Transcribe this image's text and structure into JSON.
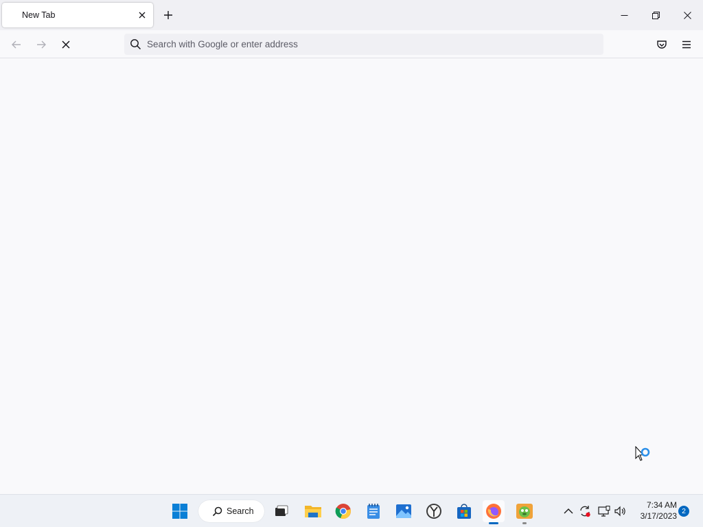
{
  "tab": {
    "title": "New Tab"
  },
  "urlbar": {
    "placeholder": "Search with Google or enter address",
    "value": ""
  },
  "taskbar": {
    "search_label": "Search",
    "apps": [
      "start",
      "task-view",
      "file-explorer",
      "chrome",
      "notepad",
      "photos",
      "clock",
      "microsoft-store",
      "firefox",
      "game"
    ],
    "active_app": "firefox"
  },
  "tray": {
    "time": "7:34 AM",
    "date": "3/17/2023",
    "notification_count": "2"
  },
  "colors": {
    "accent": "#0067c0",
    "tab_strip": "#f0f0f4",
    "page_bg": "#f9f9fb"
  }
}
